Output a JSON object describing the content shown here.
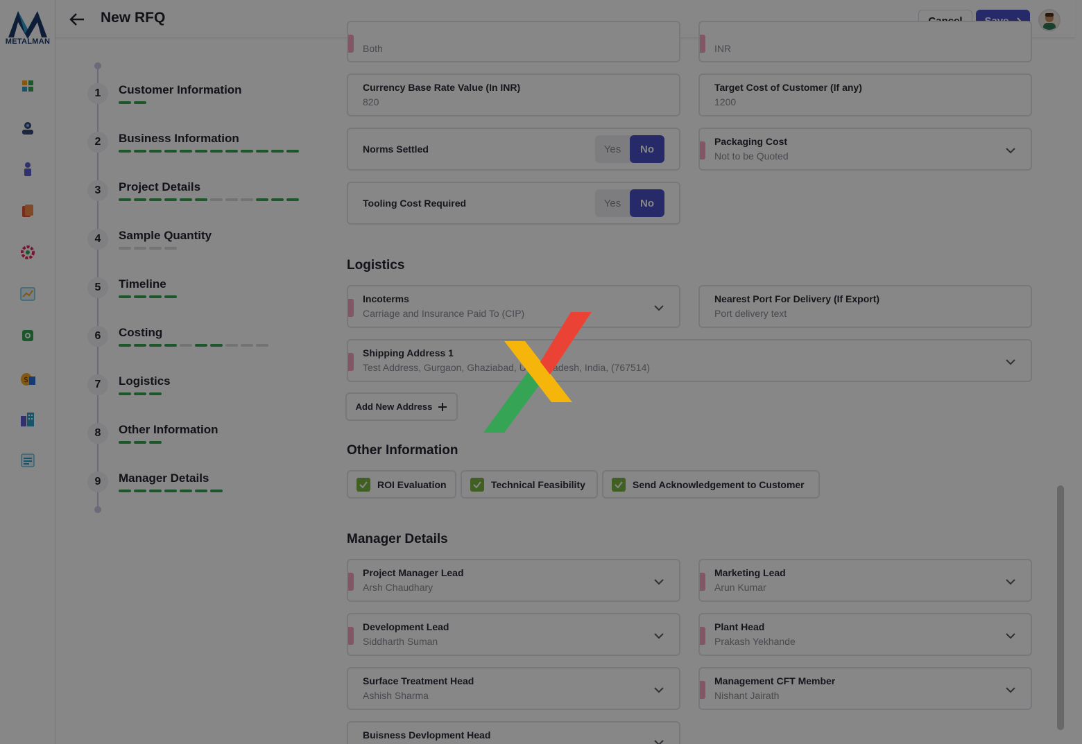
{
  "brand": {
    "name": "METALMAN"
  },
  "header": {
    "title": "New RFQ",
    "cancel_label": "Cancel",
    "save_label": "Save"
  },
  "nav_icons": [
    "dashboard-icon",
    "customers-icon",
    "user-icon",
    "documents-icon",
    "settings-gear-icon",
    "reports-chart-icon",
    "camera-icon",
    "finance-icon",
    "buildings-icon",
    "invoice-icon"
  ],
  "steps": [
    {
      "num": "1",
      "title": "Customer Information",
      "progress": [
        1,
        1
      ]
    },
    {
      "num": "2",
      "title": "Business Information",
      "progress": [
        1,
        1,
        1,
        1,
        1,
        1,
        1,
        1,
        1,
        1,
        1,
        1
      ]
    },
    {
      "num": "3",
      "title": "Project Details",
      "progress": [
        1,
        1,
        1,
        1,
        1,
        1,
        0,
        0,
        0,
        1,
        1,
        1
      ]
    },
    {
      "num": "4",
      "title": "Sample Quantity",
      "progress": [
        0,
        0,
        0,
        0
      ]
    },
    {
      "num": "5",
      "title": "Timeline",
      "progress": [
        1,
        1,
        1,
        1
      ]
    },
    {
      "num": "6",
      "title": "Costing",
      "progress": [
        1,
        1,
        1,
        1,
        0,
        1,
        1,
        0,
        0,
        0
      ]
    },
    {
      "num": "7",
      "title": "Logistics",
      "progress": [
        1,
        1,
        1
      ]
    },
    {
      "num": "8",
      "title": "Other Information",
      "progress": [
        1,
        1,
        1
      ]
    },
    {
      "num": "9",
      "title": "Manager Details",
      "progress": [
        1,
        1,
        1,
        1,
        1,
        1,
        1
      ]
    }
  ],
  "costing": {
    "top_left_value": "Both",
    "top_right_value": "INR",
    "currency_base_rate": {
      "label": "Currency Base Rate Value (In INR)",
      "value": "820"
    },
    "target_cost": {
      "label": "Target Cost of Customer (If any)",
      "value": "1200"
    },
    "norms_settled": {
      "label": "Norms Settled",
      "yes": "Yes",
      "no": "No"
    },
    "packaging_cost": {
      "label": "Packaging Cost",
      "value": "Not to be Quoted"
    },
    "tooling_cost": {
      "label": "Tooling Cost Required",
      "yes": "Yes",
      "no": "No"
    }
  },
  "logistics": {
    "title": "Logistics",
    "incoterms": {
      "label": "Incoterms",
      "value": "Carriage and Insurance Paid To (CIP)"
    },
    "nearest_port": {
      "label": "Nearest Port For Delivery (If Export)",
      "value": "Port delivery text"
    },
    "shipping_address": {
      "label": "Shipping Address 1",
      "value": "Test Address, Gurgaon, Ghaziabad, Uttar Pradesh, India, (767514)"
    },
    "add_address_label": "Add New Address"
  },
  "other_information": {
    "title": "Other Information",
    "checks": [
      "ROI Evaluation",
      "Technical Feasibility",
      "Send Acknowledgement to Customer"
    ]
  },
  "manager_details": {
    "title": "Manager Details",
    "project_manager_lead": {
      "label": "Project Manager Lead",
      "value": "Arsh Chaudhary"
    },
    "marketing_lead": {
      "label": "Marketing Lead",
      "value": "Arun Kumar"
    },
    "development_lead": {
      "label": "Development Lead",
      "value": "Siddharth Suman"
    },
    "plant_head": {
      "label": "Plant Head",
      "value": "Prakash Yekhande"
    },
    "surface_treatment_head": {
      "label": "Surface Treatment Head",
      "value": "Ashish Sharma"
    },
    "management_cft_member": {
      "label": "Management CFT Member",
      "value": "Nishant Jairath"
    },
    "business_development_head": {
      "label": "Buisness Devlopment Head"
    }
  },
  "colors": {
    "primary": "#4a50c7",
    "progress_done": "#35a454",
    "progress_pending": "#d9d9d9",
    "required_marker": "#f3a3bf",
    "overlay": "rgba(0,0,0,0.47)"
  }
}
